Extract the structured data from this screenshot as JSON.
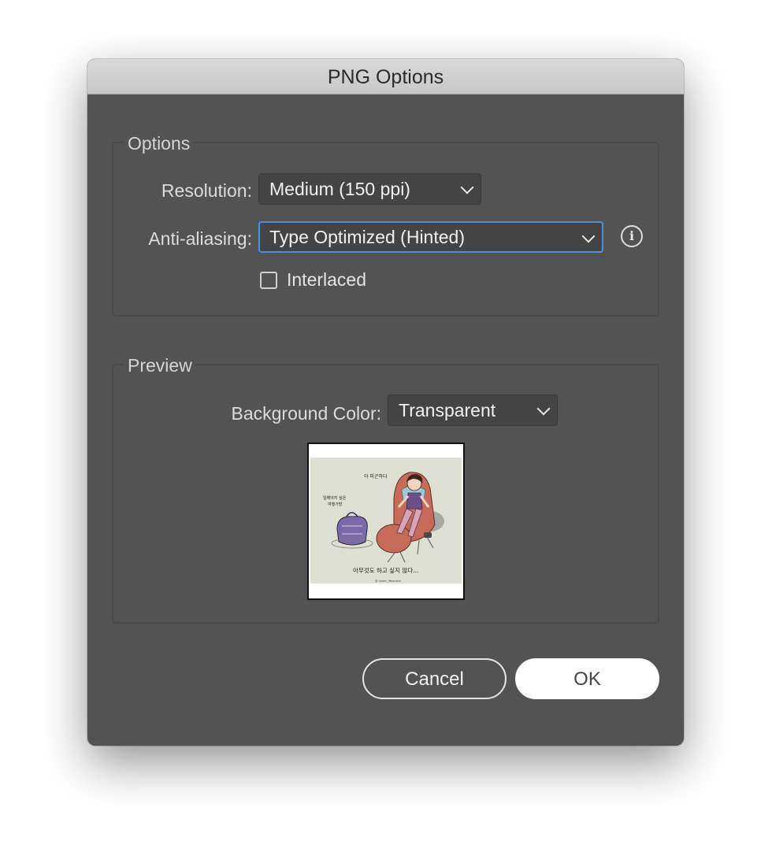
{
  "dialog": {
    "title": "PNG Options"
  },
  "options_group": {
    "title": "Options",
    "resolution_label": "Resolution:",
    "resolution_value": "Medium (150 ppi)",
    "antialiasing_label": "Anti-aliasing:",
    "antialiasing_value": "Type Optimized (Hinted)",
    "interlaced_label": "Interlaced",
    "interlaced_checked": false,
    "info_icon": "info-circle-icon"
  },
  "preview_group": {
    "title": "Preview",
    "background_label": "Background Color:",
    "background_value": "Transparent",
    "thumbnail": {
      "text_top": "아 피곤하다",
      "text_left_line1": "일해야지 싶은",
      "text_left_line2": "여행가방",
      "caption": "아무것도 하고 싶지 않다...",
      "credit": "@ comic_lifeonsite"
    }
  },
  "buttons": {
    "cancel": "Cancel",
    "ok": "OK"
  },
  "colors": {
    "dialog_bg": "#535353",
    "focus_ring": "#4b8fe0",
    "thumbnail_bg": "#dde0d3"
  }
}
